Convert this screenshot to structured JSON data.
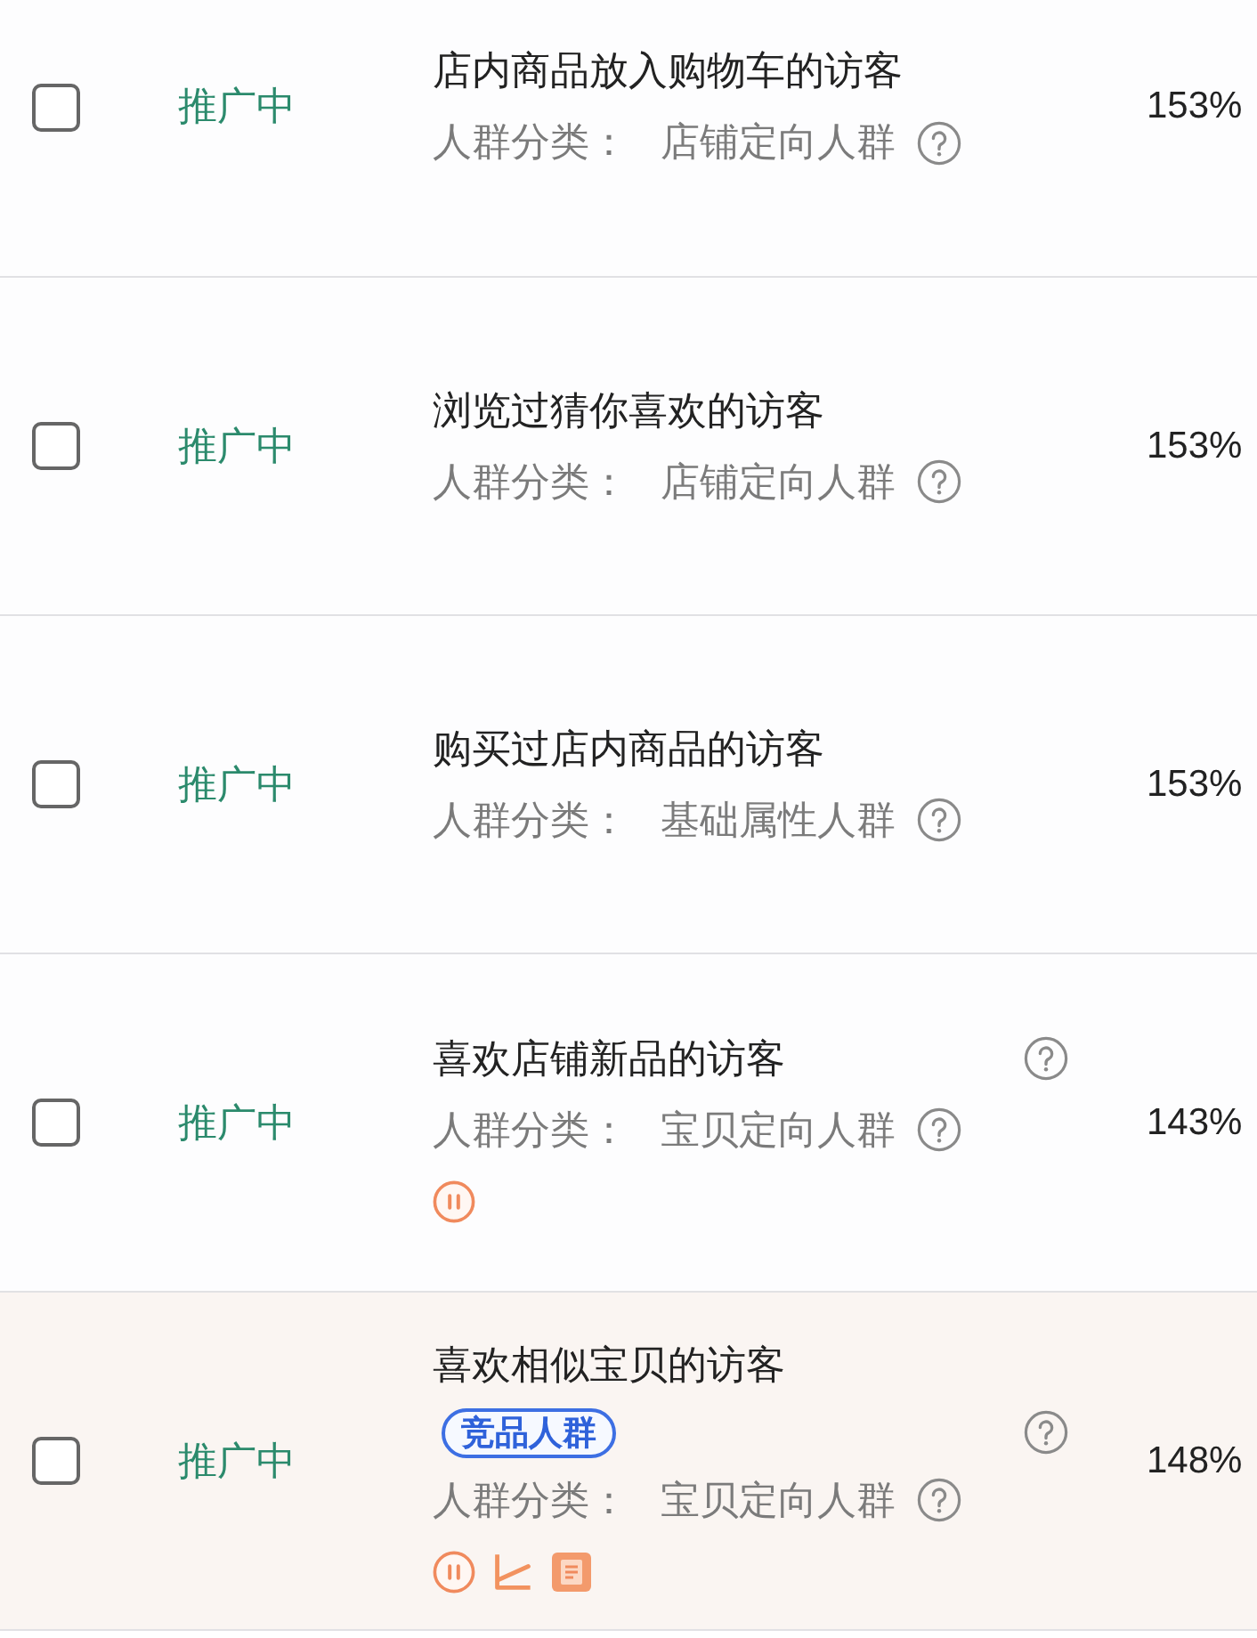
{
  "rows": [
    {
      "checked": false,
      "status": "推广中",
      "title": "店内商品放入购物车的访客",
      "title_help": false,
      "category_label": "人群分类：",
      "category": "店铺定向人群",
      "column_4": "153%",
      "highlighted": false
    },
    {
      "checked": false,
      "status": "推广中",
      "title": "浏览过猜你喜欢的访客",
      "title_help": false,
      "category_label": "人群分类：",
      "category": "店铺定向人群",
      "column_4": "153%",
      "highlighted": false
    },
    {
      "checked": false,
      "status": "推广中",
      "title": "购买过店内商品的访客",
      "title_help": false,
      "category_label": "人群分类：",
      "category": "基础属性人群",
      "column_4": "153%",
      "highlighted": false
    },
    {
      "checked": false,
      "status": "推广中",
      "title": "喜欢店铺新品的访客",
      "title_help": true,
      "category_label": "人群分类：",
      "category": "宝贝定向人群",
      "actions": [
        {
          "kind": "pause"
        }
      ],
      "column_4": "143%",
      "highlighted": false
    },
    {
      "checked": false,
      "status": "推广中",
      "title": "喜欢相似宝贝的访客",
      "tag": "竞品人群",
      "title_help": true,
      "category_label": "人群分类：",
      "category": "宝贝定向人群",
      "actions": [
        {
          "kind": "pause"
        },
        {
          "kind": "chart"
        },
        {
          "kind": "report"
        }
      ],
      "column_4": "148%",
      "highlighted": true
    }
  ]
}
